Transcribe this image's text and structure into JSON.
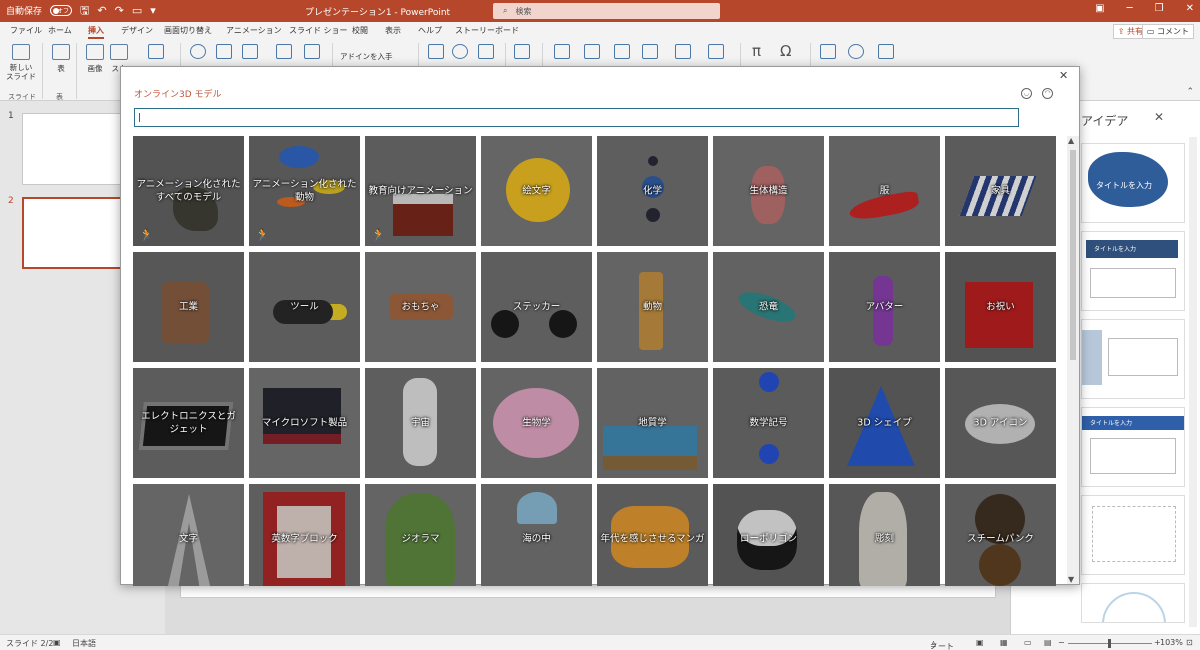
{
  "titlebar": {
    "autosave_label": "自動保存",
    "autosave_state": "オフ",
    "title": "プレゼンテーション1 - PowerPoint",
    "search_placeholder": "検索"
  },
  "tabs": [
    "ファイル",
    "ホーム",
    "挿入",
    "デザイン",
    "画面切り替え",
    "アニメーション",
    "スライド ショー",
    "校閲",
    "表示",
    "ヘルプ",
    "ストーリーボード"
  ],
  "active_tab": "挿入",
  "share_label": "共有",
  "comment_label": "コメント",
  "ribbon": {
    "new_slide": "新しい\nスライド",
    "table": "表",
    "image": "画像",
    "screenshot": "スク",
    "addins": "アドインを入手",
    "group_slides": "スライド",
    "group_table": "表"
  },
  "thumbnails": [
    "1",
    "2"
  ],
  "design_pane": {
    "title": "アイデア",
    "snippets": [
      "タイトルを入力",
      "タイトルを入力",
      "タイトルを入力"
    ]
  },
  "dialog": {
    "title": "オンライン3D モデル",
    "search_value": "|",
    "tiles": [
      {
        "label": "アニメーション化された\nすべてのモデル",
        "animated": true
      },
      {
        "label": "アニメーション化された\n動物",
        "animated": true
      },
      {
        "label": "教育向けアニメーション",
        "animated": true
      },
      {
        "label": "絵文字",
        "animated": false
      },
      {
        "label": "化学",
        "animated": false
      },
      {
        "label": "生体構造",
        "animated": false
      },
      {
        "label": "服",
        "animated": false
      },
      {
        "label": "家具",
        "animated": false
      },
      {
        "label": "工業",
        "animated": false
      },
      {
        "label": "ツール",
        "animated": false
      },
      {
        "label": "おもちゃ",
        "animated": false
      },
      {
        "label": "ステッカー",
        "animated": false
      },
      {
        "label": "動物",
        "animated": false
      },
      {
        "label": "恐竜",
        "animated": false
      },
      {
        "label": "アバター",
        "animated": false
      },
      {
        "label": "お祝い",
        "animated": false
      },
      {
        "label": "エレクトロニクスとガ\nジェット",
        "animated": false
      },
      {
        "label": "マイクロソフト製品",
        "animated": false
      },
      {
        "label": "宇宙",
        "animated": false
      },
      {
        "label": "生物学",
        "animated": false
      },
      {
        "label": "地質学",
        "animated": false
      },
      {
        "label": "数学記号",
        "animated": false
      },
      {
        "label": "3D シェイプ",
        "animated": false
      },
      {
        "label": "3D アイコン",
        "animated": false
      },
      {
        "label": "文字",
        "animated": false
      },
      {
        "label": "英数字ブロック",
        "animated": false
      },
      {
        "label": "ジオラマ",
        "animated": false
      },
      {
        "label": "海の中",
        "animated": false
      },
      {
        "label": "年代を感じさせるマンガ",
        "animated": false
      },
      {
        "label": "ローポリゴン",
        "animated": false
      },
      {
        "label": "彫刻",
        "animated": false
      },
      {
        "label": "スチームパンク",
        "animated": false
      }
    ]
  },
  "statusbar": {
    "slide": "スライド 2/2",
    "language": "日本語",
    "notes": "ノート",
    "zoom": "103%"
  }
}
